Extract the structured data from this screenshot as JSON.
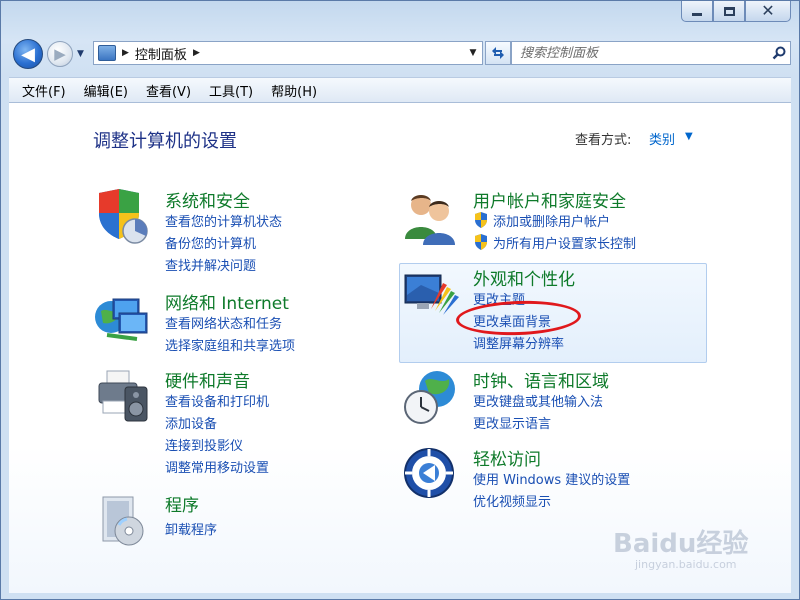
{
  "window": {
    "caption_buttons": [
      "minimize",
      "maximize",
      "close"
    ]
  },
  "nav": {
    "address_crumb": "控制面板",
    "search_placeholder": "搜索控制面板"
  },
  "menubar": {
    "items": [
      "文件(F)",
      "编辑(E)",
      "查看(V)",
      "工具(T)",
      "帮助(H)"
    ]
  },
  "main": {
    "title": "调整计算机的设置",
    "view_by_label": "查看方式:",
    "view_by_value": "类别",
    "categories": {
      "system_security": {
        "title": "系统和安全",
        "links": [
          "查看您的计算机状态",
          "备份您的计算机",
          "查找并解决问题"
        ]
      },
      "network": {
        "title": "网络和 Internet",
        "links": [
          "查看网络状态和任务",
          "选择家庭组和共享选项"
        ]
      },
      "hardware": {
        "title": "硬件和声音",
        "links": [
          "查看设备和打印机",
          "添加设备",
          "连接到投影仪",
          "调整常用移动设置"
        ]
      },
      "programs": {
        "title": "程序",
        "links": [
          "卸载程序"
        ]
      },
      "user_accounts": {
        "title": "用户帐户和家庭安全",
        "links": [
          "添加或删除用户帐户",
          "为所有用户设置家长控制"
        ]
      },
      "appearance": {
        "title": "外观和个性化",
        "links": [
          "更改主题",
          "更改桌面背景",
          "调整屏幕分辨率"
        ]
      },
      "clock": {
        "title": "时钟、语言和区域",
        "links": [
          "更改键盘或其他输入法",
          "更改显示语言"
        ]
      },
      "ease": {
        "title": "轻松访问",
        "links": [
          "使用 Windows 建议的设置",
          "优化视频显示"
        ]
      }
    }
  },
  "watermark": {
    "brand": "Baidu经验",
    "url": "jingyan.baidu.com"
  },
  "colors": {
    "category_title": "#0e7a2a",
    "link": "#1a4fb3",
    "page_title": "#1e3287",
    "annotation": "#e0181c"
  }
}
